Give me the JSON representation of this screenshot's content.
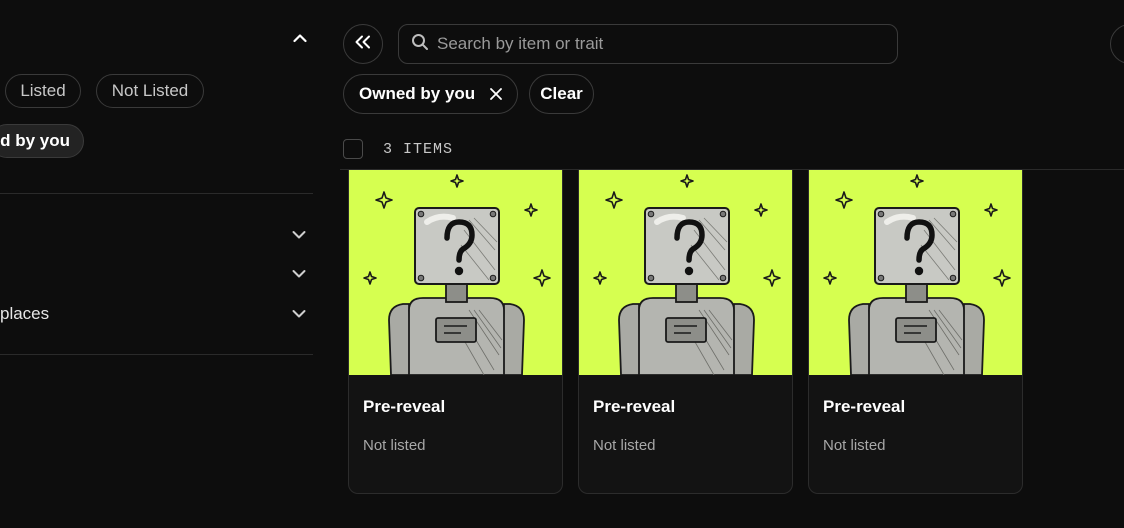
{
  "sidebar": {
    "status_pills": [
      {
        "label": "Listed"
      },
      {
        "label": "Not Listed"
      }
    ],
    "owned_pill": {
      "label": "ed by you"
    },
    "sections": [
      {
        "label": ""
      },
      {
        "label": ""
      },
      {
        "label": "places"
      }
    ]
  },
  "search": {
    "placeholder": "Search by item or trait"
  },
  "filters": {
    "active": [
      {
        "label": "Owned by you"
      }
    ],
    "clear_label": "Clear"
  },
  "results": {
    "count_label": "3 ITEMS",
    "items": [
      {
        "name": "Pre-reveal",
        "status": "Not listed"
      },
      {
        "name": "Pre-reveal",
        "status": "Not listed"
      },
      {
        "name": "Pre-reveal",
        "status": "Not listed"
      }
    ]
  },
  "colors": {
    "background": "#0d0d0d",
    "card_art_bg": "#d6ff50",
    "border": "#3a3a3a"
  }
}
